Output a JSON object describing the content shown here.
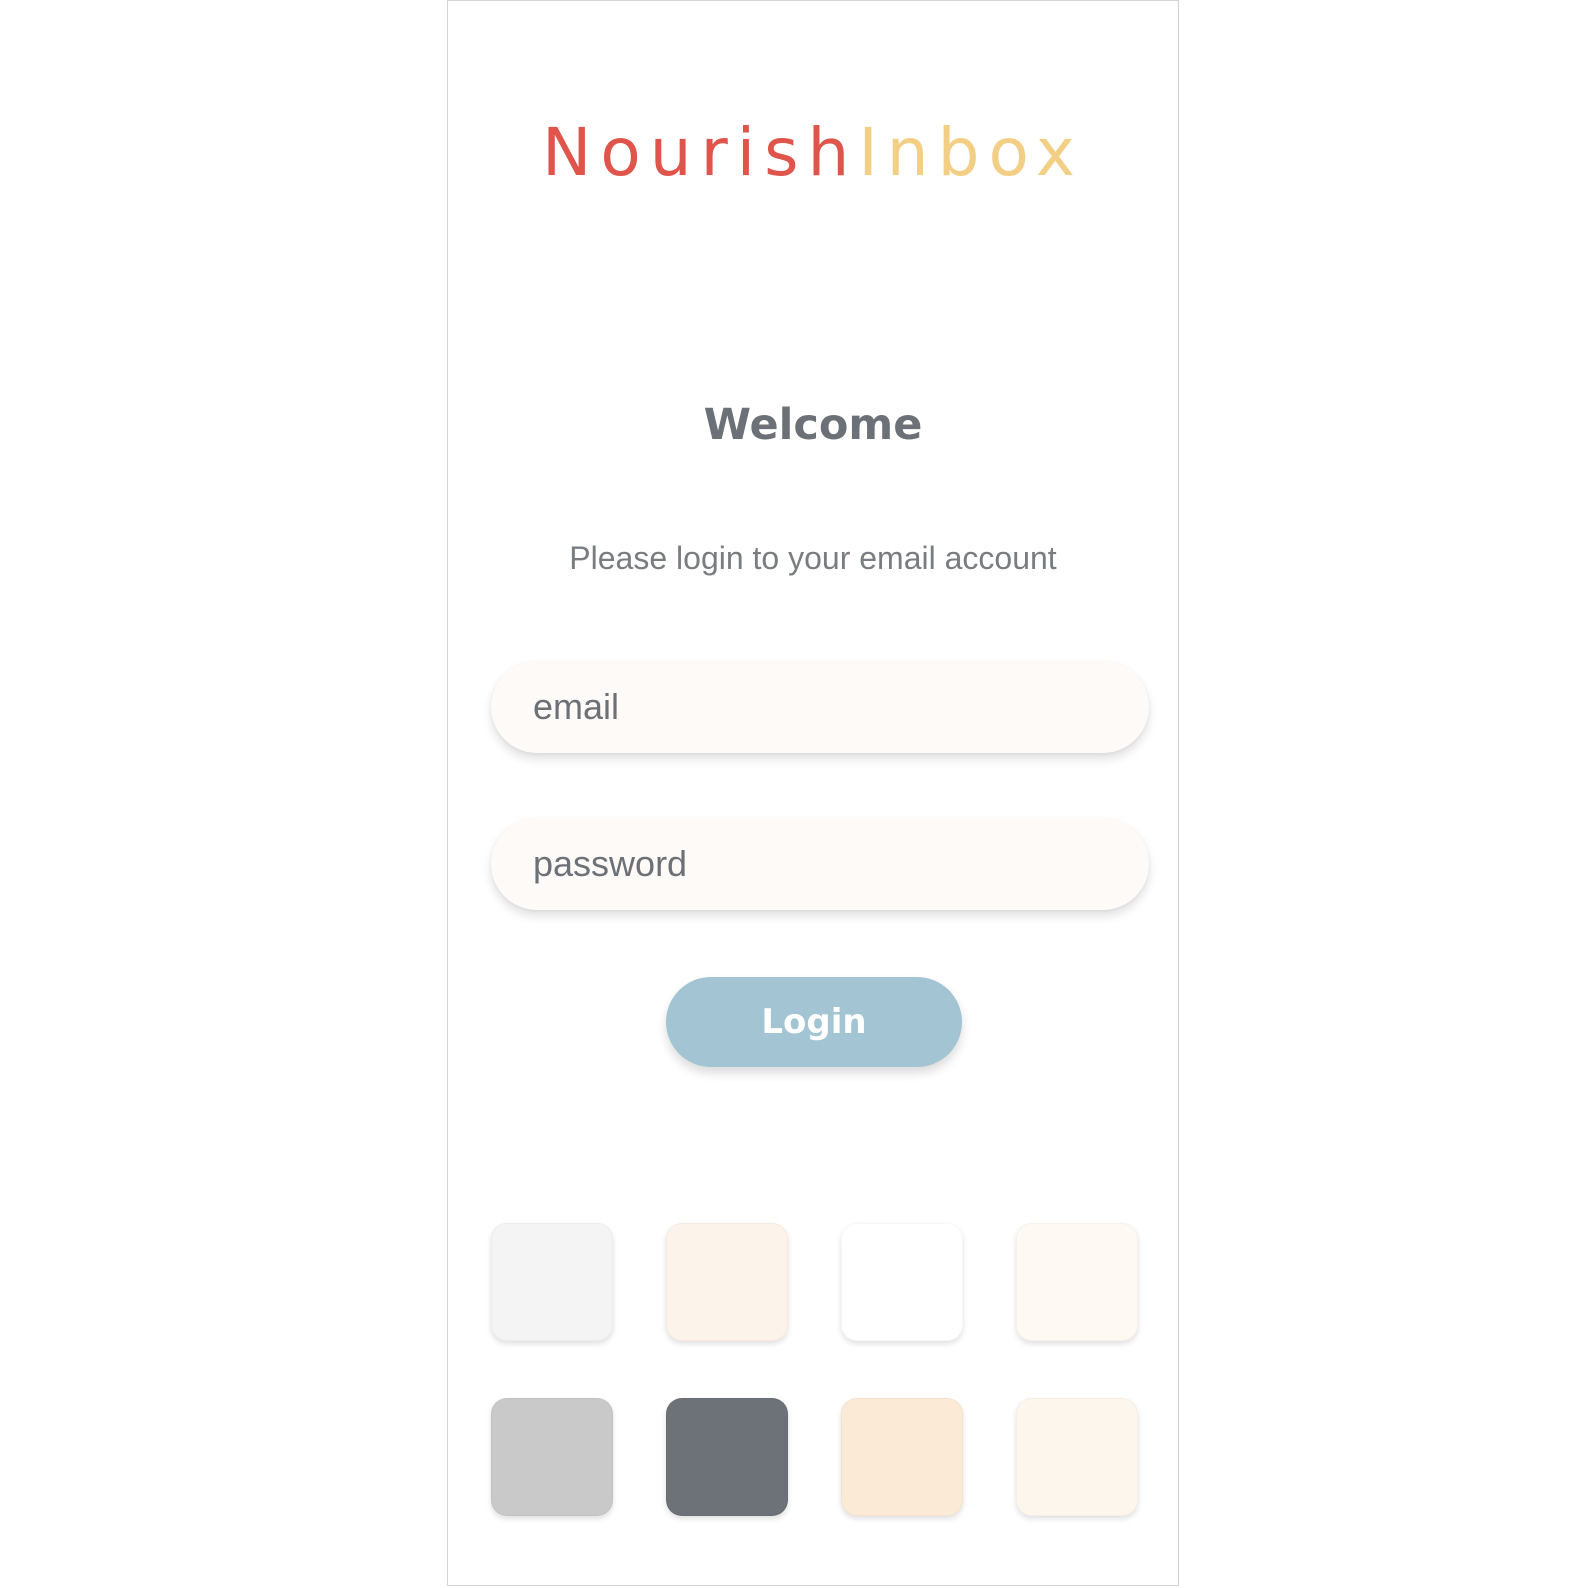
{
  "logo": {
    "part1": "Nourish",
    "part2": "Inbox",
    "colors": {
      "part1": "#e0554b",
      "part2": "#f3cf86"
    }
  },
  "heading": "Welcome",
  "subheading": "Please login to your email account",
  "form": {
    "email_placeholder": "email",
    "password_placeholder": "password",
    "login_label": "Login",
    "login_color": "#a2c4d3"
  },
  "palette": [
    "#f4f4f4",
    "#fcf3ea",
    "#ffffff",
    "#fefaf3",
    "#cac9c9",
    "#6c7278",
    "#fbead6",
    "#fdf6ed"
  ]
}
